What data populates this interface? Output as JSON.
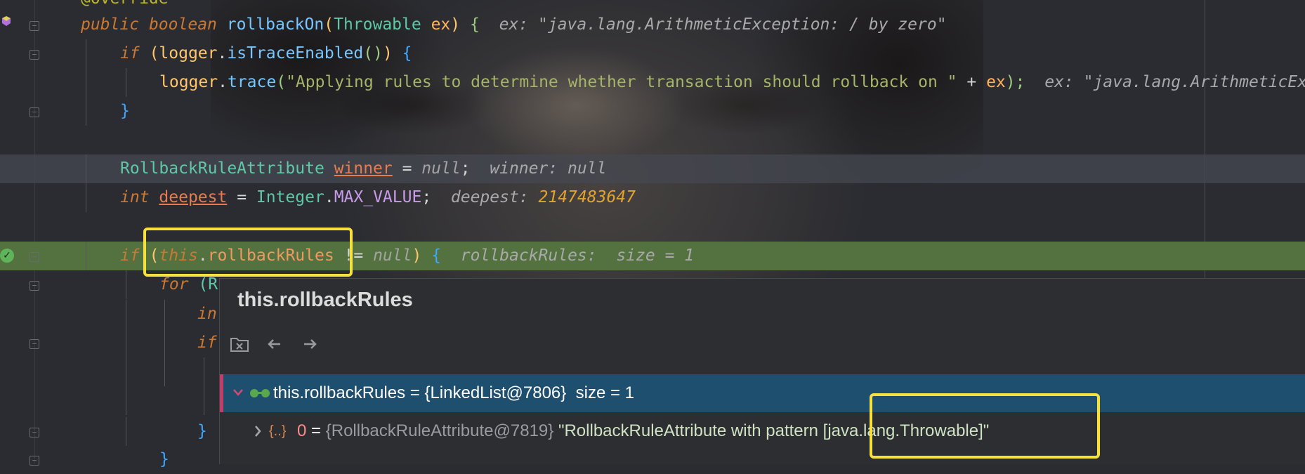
{
  "editor": {
    "lines": {
      "l0": {
        "annotation": "@Override"
      },
      "l1": {
        "public": "public",
        "boolean": "boolean",
        "method": "rollbackOn",
        "paren_open": "(",
        "param_type": "Throwable",
        "param": "ex",
        "paren_close": ")",
        "brace": "{",
        "hint_label": "ex:",
        "hint_value": "\"java.lang.ArithmeticException: / by zero\""
      },
      "l2": {
        "if": "if",
        "open": "(",
        "logger": "logger",
        "dot": ".",
        "call": "isTraceEnabled",
        "call_parens": "()",
        "close": ")",
        "brace": "{"
      },
      "l3": {
        "logger": "logger",
        "dot": ".",
        "call": "trace",
        "open": "(",
        "str": "\"Applying rules to determine whether transaction should rollback on \"",
        "plus": " + ",
        "arg": "ex",
        "close": ");",
        "hint_label": "ex:",
        "hint_value": "\"java.lang.ArithmeticEx"
      },
      "l4": {
        "brace": "}"
      },
      "l5": {
        "type": "RollbackRuleAttribute",
        "var": "winner",
        "assign": " = ",
        "null": "null",
        "semi": ";",
        "hint_label": "winner:",
        "hint_value": "null"
      },
      "l6": {
        "int": "int",
        "var": "deepest",
        "assign": " = ",
        "class": "Integer",
        "dot": ".",
        "const": "MAX_VALUE",
        "semi": ";",
        "hint_label": "deepest:",
        "hint_value": "2147483647"
      },
      "l7": {
        "if": "if",
        "open": "(",
        "this": "this",
        "dot": ".",
        "field": "rollbackRules",
        "neq": " != ",
        "null": "null",
        "close": ")",
        "brace": "{",
        "hint_label": "rollbackRules:",
        "hint_value": "size = 1"
      },
      "l8": {
        "for": "for",
        "open": "(R"
      },
      "l9": {
        "frag": "in"
      },
      "l10": {
        "frag": "if"
      },
      "l11": {
        "brace": "}"
      },
      "l12": {
        "brace": "}"
      }
    }
  },
  "popup": {
    "title": "this.rollbackRules",
    "toolbar": {
      "remove_icon": "folder-remove-icon",
      "back_icon": "arrow-left-icon",
      "forward_icon": "arrow-right-icon"
    },
    "root": {
      "name": "this.rollbackRules",
      "eq": " = ",
      "value": "{LinkedList@7806}",
      "size": "size = 1"
    },
    "child": {
      "index": "0",
      "eq": " = ",
      "ref": "{RollbackRuleAttribute@7819}",
      "text": "\"RollbackRuleAttribute with pattern [java.lang.Throwable]\""
    }
  },
  "colors": {
    "keyword": "#cc7832",
    "type": "#5fc9a6",
    "exec_line": "#53723f",
    "highlight_box": "#f5e03c",
    "tree_selection": "#1f4f6f"
  }
}
